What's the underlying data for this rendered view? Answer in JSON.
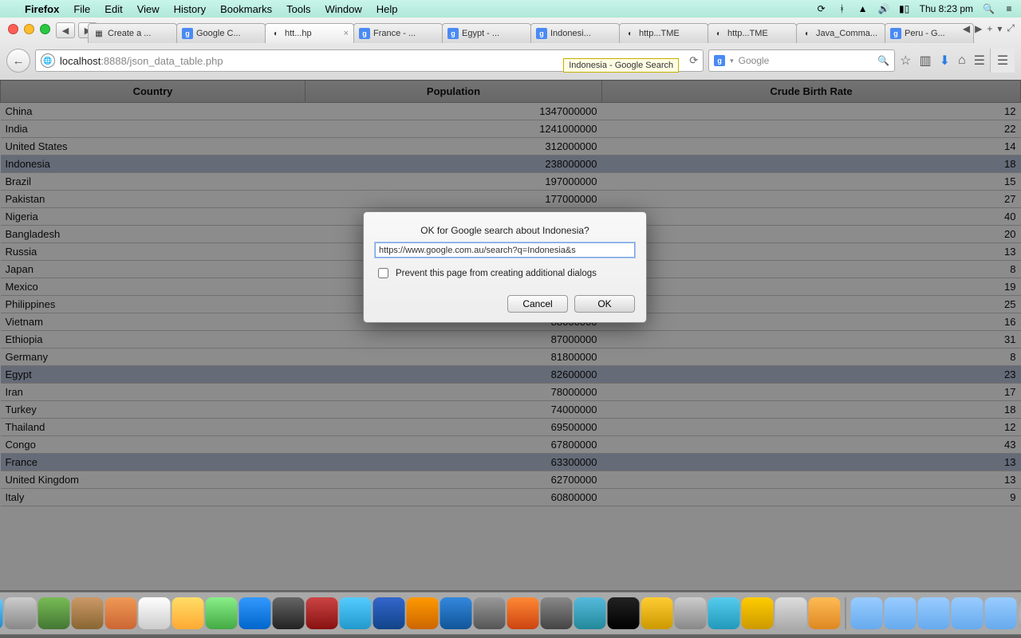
{
  "menubar": {
    "app": "Firefox",
    "items": [
      "File",
      "Edit",
      "View",
      "History",
      "Bookmarks",
      "Tools",
      "Window",
      "Help"
    ],
    "clock": "Thu 8:23 pm"
  },
  "tabs": [
    {
      "label": "Create a ...",
      "favicon": "my"
    },
    {
      "label": "Google C...",
      "favicon": "g"
    },
    {
      "label": "htt...hp",
      "favicon": "",
      "active": true
    },
    {
      "label": "France - ...",
      "favicon": "g"
    },
    {
      "label": "Egypt - ...",
      "favicon": "g"
    },
    {
      "label": "Indonesi...",
      "favicon": "g"
    },
    {
      "label": "http...TME",
      "favicon": ""
    },
    {
      "label": "http...TME",
      "favicon": ""
    },
    {
      "label": "Java_Comma...",
      "favicon": ""
    },
    {
      "label": "Peru - G...",
      "favicon": "g"
    }
  ],
  "url": {
    "host": "localhost",
    "port": ":8888",
    "path": "/json_data_table.php",
    "tooltip": "Indonesia - Google Search"
  },
  "search": {
    "placeholder": "Google"
  },
  "table": {
    "headers": [
      "Country",
      "Population",
      "Crude Birth Rate"
    ],
    "rows": [
      {
        "country": "China",
        "population": "1347000000",
        "rate": "12"
      },
      {
        "country": "India",
        "population": "1241000000",
        "rate": "22"
      },
      {
        "country": "United States",
        "population": "312000000",
        "rate": "14"
      },
      {
        "country": "Indonesia",
        "population": "238000000",
        "rate": "18",
        "hl": true
      },
      {
        "country": "Brazil",
        "population": "197000000",
        "rate": "15"
      },
      {
        "country": "Pakistan",
        "population": "177000000",
        "rate": "27"
      },
      {
        "country": "Nigeria",
        "population": "",
        "rate": "40"
      },
      {
        "country": "Bangladesh",
        "population": "",
        "rate": "20"
      },
      {
        "country": "Russia",
        "population": "",
        "rate": "13"
      },
      {
        "country": "Japan",
        "population": "",
        "rate": "8"
      },
      {
        "country": "Mexico",
        "population": "",
        "rate": "19"
      },
      {
        "country": "Philippines",
        "population": "",
        "rate": "25"
      },
      {
        "country": "Vietnam",
        "population": "88000000",
        "rate": "16"
      },
      {
        "country": "Ethiopia",
        "population": "87000000",
        "rate": "31"
      },
      {
        "country": "Germany",
        "population": "81800000",
        "rate": "8"
      },
      {
        "country": "Egypt",
        "population": "82600000",
        "rate": "23",
        "hl": true
      },
      {
        "country": "Iran",
        "population": "78000000",
        "rate": "17"
      },
      {
        "country": "Turkey",
        "population": "74000000",
        "rate": "18"
      },
      {
        "country": "Thailand",
        "population": "69500000",
        "rate": "12"
      },
      {
        "country": "Congo",
        "population": "67800000",
        "rate": "43"
      },
      {
        "country": "France",
        "population": "63300000",
        "rate": "13",
        "hl": true
      },
      {
        "country": "United Kingdom",
        "population": "62700000",
        "rate": "13"
      },
      {
        "country": "Italy",
        "population": "60800000",
        "rate": "9"
      }
    ]
  },
  "dialog": {
    "message": "OK for Google search about Indonesia?",
    "input": "https://www.google.com.au/search?q=Indonesia&s",
    "checkbox": "Prevent this page from creating additional dialogs",
    "cancel": "Cancel",
    "ok": "OK"
  }
}
